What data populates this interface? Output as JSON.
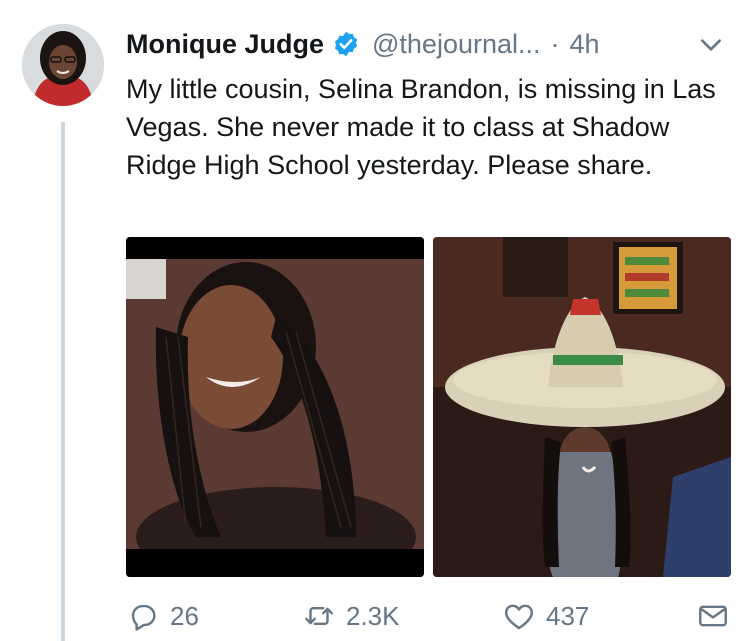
{
  "tweet": {
    "author": {
      "name": "Monique Judge",
      "handle": "@thejournal...",
      "verified": true
    },
    "separator": "·",
    "time": "4h",
    "text": "My little cousin, Selina Brandon, is missing in Las Vegas. She never made it to class at Shadow Ridge High School yesterday. Please share.",
    "media_count": 2
  },
  "actions": {
    "replies": "26",
    "retweets": "2.3K",
    "likes": "437"
  },
  "icons": {
    "verified": "verified-badge-icon",
    "more": "chevron-down-icon",
    "reply": "reply-icon",
    "retweet": "retweet-icon",
    "like": "heart-icon",
    "message": "envelope-icon"
  },
  "colors": {
    "verified": "#1da1f2",
    "secondary_text": "#657786",
    "thread_line": "#ccd6dd"
  }
}
